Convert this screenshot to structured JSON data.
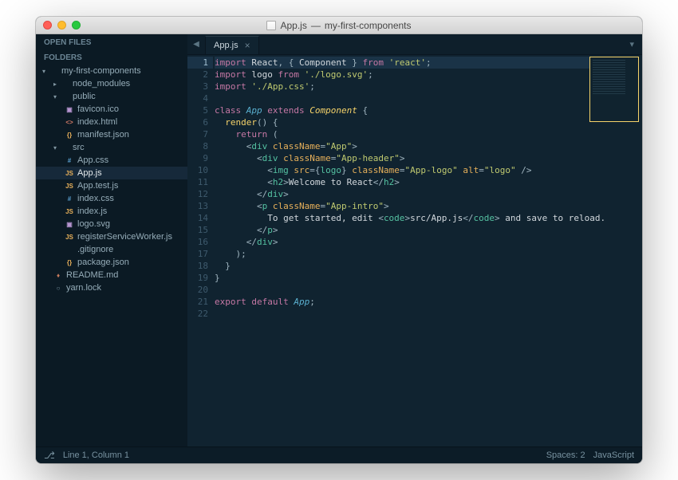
{
  "window": {
    "title_file": "App.js",
    "title_project": "my-first-components"
  },
  "sidebar": {
    "open_files_header": "OPEN FILES",
    "folders_header": "FOLDERS",
    "tree": [
      {
        "label": "my-first-components",
        "depth": 1,
        "kind": "folder-open"
      },
      {
        "label": "node_modules",
        "depth": 2,
        "kind": "folder"
      },
      {
        "label": "public",
        "depth": 2,
        "kind": "folder-open"
      },
      {
        "label": "favicon.ico",
        "depth": 3,
        "kind": "image"
      },
      {
        "label": "index.html",
        "depth": 3,
        "kind": "html"
      },
      {
        "label": "manifest.json",
        "depth": 3,
        "kind": "json"
      },
      {
        "label": "src",
        "depth": 2,
        "kind": "folder-open"
      },
      {
        "label": "App.css",
        "depth": 3,
        "kind": "css"
      },
      {
        "label": "App.js",
        "depth": 3,
        "kind": "js",
        "active": true
      },
      {
        "label": "App.test.js",
        "depth": 3,
        "kind": "js"
      },
      {
        "label": "index.css",
        "depth": 3,
        "kind": "css"
      },
      {
        "label": "index.js",
        "depth": 3,
        "kind": "js"
      },
      {
        "label": "logo.svg",
        "depth": 3,
        "kind": "image"
      },
      {
        "label": "registerServiceWorker.js",
        "depth": 3,
        "kind": "js"
      },
      {
        "label": ".gitignore",
        "depth": 3,
        "kind": "text"
      },
      {
        "label": "package.json",
        "depth": 3,
        "kind": "json"
      },
      {
        "label": "README.md",
        "depth": 2,
        "kind": "md"
      },
      {
        "label": "yarn.lock",
        "depth": 2,
        "kind": "lock"
      }
    ]
  },
  "tabs": {
    "active": "App.js"
  },
  "code": {
    "highlighted_line": 1,
    "lines": [
      [
        [
          "kw",
          "import"
        ],
        [
          "txt",
          " React"
        ],
        [
          "pn",
          ", { "
        ],
        [
          "txt",
          "Component"
        ],
        [
          "pn",
          " } "
        ],
        [
          "kw",
          "from"
        ],
        [
          "txt",
          " "
        ],
        [
          "str",
          "'react'"
        ],
        [
          "pn",
          ";"
        ]
      ],
      [
        [
          "kw",
          "import"
        ],
        [
          "txt",
          " logo "
        ],
        [
          "kw",
          "from"
        ],
        [
          "txt",
          " "
        ],
        [
          "str",
          "'./logo.svg'"
        ],
        [
          "pn",
          ";"
        ]
      ],
      [
        [
          "kw",
          "import"
        ],
        [
          "txt",
          " "
        ],
        [
          "str",
          "'./App.css'"
        ],
        [
          "pn",
          ";"
        ]
      ],
      [],
      [
        [
          "kw",
          "class"
        ],
        [
          "txt",
          " "
        ],
        [
          "cls",
          "App"
        ],
        [
          "txt",
          " "
        ],
        [
          "kw",
          "extends"
        ],
        [
          "txt",
          " "
        ],
        [
          "cmp",
          "Component"
        ],
        [
          "txt",
          " "
        ],
        [
          "pn",
          "{"
        ]
      ],
      [
        [
          "txt",
          "  "
        ],
        [
          "fn",
          "render"
        ],
        [
          "pn",
          "() {"
        ]
      ],
      [
        [
          "txt",
          "    "
        ],
        [
          "kw",
          "return"
        ],
        [
          "txt",
          " "
        ],
        [
          "pn",
          "("
        ]
      ],
      [
        [
          "txt",
          "      "
        ],
        [
          "pn",
          "<"
        ],
        [
          "tag",
          "div"
        ],
        [
          "txt",
          " "
        ],
        [
          "attr",
          "className"
        ],
        [
          "eq",
          "="
        ],
        [
          "str",
          "\"App\""
        ],
        [
          "pn",
          ">"
        ]
      ],
      [
        [
          "txt",
          "        "
        ],
        [
          "pn",
          "<"
        ],
        [
          "tag",
          "div"
        ],
        [
          "txt",
          " "
        ],
        [
          "attr",
          "className"
        ],
        [
          "eq",
          "="
        ],
        [
          "str",
          "\"App-header\""
        ],
        [
          "pn",
          ">"
        ]
      ],
      [
        [
          "txt",
          "          "
        ],
        [
          "pn",
          "<"
        ],
        [
          "tag",
          "img"
        ],
        [
          "txt",
          " "
        ],
        [
          "attr",
          "src"
        ],
        [
          "eq",
          "="
        ],
        [
          "pn",
          "{"
        ],
        [
          "jsvar",
          "logo"
        ],
        [
          "pn",
          "}"
        ],
        [
          "txt",
          " "
        ],
        [
          "attr",
          "className"
        ],
        [
          "eq",
          "="
        ],
        [
          "str",
          "\"App-logo\""
        ],
        [
          "txt",
          " "
        ],
        [
          "attr",
          "alt"
        ],
        [
          "eq",
          "="
        ],
        [
          "str",
          "\"logo\""
        ],
        [
          "txt",
          " "
        ],
        [
          "pn",
          "/>"
        ]
      ],
      [
        [
          "txt",
          "          "
        ],
        [
          "pn",
          "<"
        ],
        [
          "tag",
          "h2"
        ],
        [
          "pn",
          ">"
        ],
        [
          "txt",
          "Welcome to React"
        ],
        [
          "pn",
          "</"
        ],
        [
          "tag",
          "h2"
        ],
        [
          "pn",
          ">"
        ]
      ],
      [
        [
          "txt",
          "        "
        ],
        [
          "pn",
          "</"
        ],
        [
          "tag",
          "div"
        ],
        [
          "pn",
          ">"
        ]
      ],
      [
        [
          "txt",
          "        "
        ],
        [
          "pn",
          "<"
        ],
        [
          "tag",
          "p"
        ],
        [
          "txt",
          " "
        ],
        [
          "attr",
          "className"
        ],
        [
          "eq",
          "="
        ],
        [
          "str",
          "\"App-intro\""
        ],
        [
          "pn",
          ">"
        ]
      ],
      [
        [
          "txt",
          "          To get started, edit "
        ],
        [
          "pn",
          "<"
        ],
        [
          "tag",
          "code"
        ],
        [
          "pn",
          ">"
        ],
        [
          "txt",
          "src/App.js"
        ],
        [
          "pn",
          "</"
        ],
        [
          "tag",
          "code"
        ],
        [
          "pn",
          ">"
        ],
        [
          "txt",
          " and save to reload."
        ]
      ],
      [
        [
          "txt",
          "        "
        ],
        [
          "pn",
          "</"
        ],
        [
          "tag",
          "p"
        ],
        [
          "pn",
          ">"
        ]
      ],
      [
        [
          "txt",
          "      "
        ],
        [
          "pn",
          "</"
        ],
        [
          "tag",
          "div"
        ],
        [
          "pn",
          ">"
        ]
      ],
      [
        [
          "txt",
          "    "
        ],
        [
          "pn",
          ");"
        ]
      ],
      [
        [
          "txt",
          "  "
        ],
        [
          "pn",
          "}"
        ]
      ],
      [
        [
          "pn",
          "}"
        ]
      ],
      [],
      [
        [
          "kw",
          "export"
        ],
        [
          "txt",
          " "
        ],
        [
          "kw",
          "default"
        ],
        [
          "txt",
          " "
        ],
        [
          "cls",
          "App"
        ],
        [
          "pn",
          ";"
        ]
      ],
      []
    ]
  },
  "status": {
    "position": "Line 1, Column 1",
    "spaces": "Spaces: 2",
    "language": "JavaScript"
  },
  "icons": {
    "folder-open": "▾",
    "folder": "▸",
    "image": "▣",
    "html": "<>",
    "json": "{}",
    "css": "#",
    "js": "JS",
    "text": " ",
    "md": "♦",
    "lock": "○"
  },
  "colors": {
    "image": "#b695d0",
    "html": "#d07965",
    "json": "#e7b05a",
    "css": "#5aa0d0",
    "js": "#e7b05a",
    "md": "#c77a5c",
    "lock": "#7892a0",
    "text": "#7892a0",
    "folder": "#9fbed0",
    "folder-open": "#9fbed0"
  }
}
